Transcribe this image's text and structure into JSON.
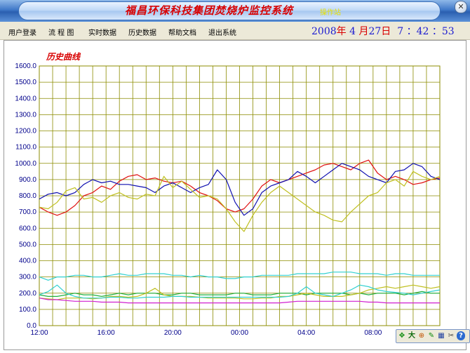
{
  "window": {
    "title": "福昌环保科技集团焚烧炉监控系统",
    "subtitle": "操作站",
    "close_glyph": "✕"
  },
  "menu": {
    "items": [
      "用户登录",
      "流 程 图",
      "实时数据",
      "历史数据",
      "帮助文档",
      "退出系统"
    ]
  },
  "clock": {
    "year": "2008",
    "year_unit": "年",
    "month": "4",
    "month_unit": "月",
    "day": "27",
    "day_unit": "日",
    "hour": "7",
    "sep1": "：",
    "minute": "42",
    "sep2": "：",
    "second": "53"
  },
  "colors": {
    "grid": "#8c8c00",
    "axis_text": "#00008b",
    "red_series": "#e01010",
    "blue_series": "#1010b0",
    "yellow_series": "#c0c020",
    "cyan_series": "#30d0d0",
    "green_series": "#20b040",
    "magenta_series": "#d020d0"
  },
  "toolbar": {
    "icons": [
      "move-icon",
      "zoom-in-icon",
      "zoom-region-icon",
      "pen-icon",
      "print-icon",
      "settings-icon",
      "help-icon"
    ],
    "glyphs": [
      "✥",
      "大",
      "⊕",
      "✎",
      "▦",
      "✂",
      "?"
    ]
  },
  "chart_data": {
    "type": "line",
    "title": "历史曲线",
    "ylim": [
      0,
      1600
    ],
    "y_ticks": [
      "0.0",
      "100.0",
      "200.0",
      "300.0",
      "400.0",
      "500.0",
      "600.0",
      "700.0",
      "800.0",
      "900.0",
      "1000.0",
      "1100.0",
      "1200.0",
      "1300.0",
      "1400.0",
      "1500.0",
      "1600.0"
    ],
    "x_ticks": [
      "12:00",
      "16:00",
      "20:00",
      "00:00",
      "04:00",
      "08:00"
    ],
    "grid": true,
    "series": [
      {
        "key": "red",
        "values": [
          730,
          700,
          680,
          700,
          740,
          800,
          820,
          860,
          840,
          890,
          920,
          930,
          900,
          910,
          890,
          880,
          890,
          860,
          820,
          800,
          770,
          720,
          700,
          720,
          780,
          860,
          900,
          880,
          900,
          920,
          940,
          960,
          990,
          1000,
          980,
          960,
          1000,
          1020,
          940,
          900,
          920,
          900,
          870,
          880,
          900,
          910
        ]
      },
      {
        "key": "blue",
        "values": [
          780,
          810,
          820,
          800,
          820,
          870,
          900,
          880,
          890,
          870,
          870,
          860,
          850,
          820,
          860,
          880,
          850,
          820,
          850,
          870,
          960,
          900,
          760,
          680,
          720,
          820,
          860,
          880,
          900,
          950,
          920,
          880,
          920,
          960,
          1000,
          980,
          960,
          920,
          900,
          880,
          950,
          960,
          1000,
          980,
          920,
          900
        ]
      },
      {
        "key": "yellow",
        "values": [
          730,
          720,
          760,
          830,
          850,
          780,
          790,
          760,
          800,
          820,
          790,
          780,
          810,
          800,
          920,
          850,
          890,
          840,
          790,
          800,
          780,
          720,
          640,
          580,
          680,
          760,
          820,
          860,
          820,
          780,
          740,
          700,
          680,
          650,
          640,
          700,
          750,
          800,
          820,
          880,
          900,
          860,
          950,
          920,
          900,
          920
        ]
      },
      {
        "key": "cyan",
        "values": [
          300,
          280,
          300,
          300,
          310,
          310,
          300,
          300,
          310,
          320,
          310,
          310,
          320,
          320,
          320,
          310,
          310,
          300,
          310,
          300,
          300,
          290,
          290,
          300,
          300,
          310,
          310,
          310,
          310,
          320,
          320,
          320,
          320,
          330,
          330,
          330,
          320,
          320,
          320,
          310,
          320,
          320,
          310,
          310,
          310,
          310
        ]
      },
      {
        "key": "green",
        "values": [
          190,
          180,
          180,
          190,
          200,
          190,
          190,
          180,
          190,
          200,
          190,
          200,
          200,
          200,
          190,
          190,
          200,
          200,
          190,
          190,
          190,
          190,
          200,
          200,
          190,
          190,
          190,
          200,
          200,
          200,
          190,
          200,
          200,
          200,
          200,
          190,
          200,
          190,
          200,
          200,
          200,
          190,
          200,
          210,
          200,
          200
        ]
      },
      {
        "key": "yellow2",
        "values": [
          170,
          165,
          160,
          170,
          170,
          170,
          165,
          170,
          180,
          180,
          175,
          180,
          200,
          230,
          190,
          180,
          180,
          180,
          175,
          170,
          170,
          170,
          170,
          165,
          165,
          170,
          170,
          180,
          180,
          190,
          200,
          190,
          180,
          180,
          180,
          190,
          200,
          220,
          230,
          240,
          230,
          240,
          250,
          240,
          230,
          240
        ]
      },
      {
        "key": "cyan2",
        "values": [
          190,
          210,
          250,
          200,
          180,
          170,
          170,
          170,
          175,
          175,
          170,
          170,
          175,
          175,
          175,
          180,
          180,
          175,
          175,
          175,
          175,
          175,
          175,
          175,
          175,
          175,
          175,
          175,
          180,
          200,
          240,
          200,
          190,
          180,
          200,
          220,
          250,
          240,
          220,
          210,
          205,
          200,
          190,
          200,
          210,
          220
        ]
      },
      {
        "key": "magenta",
        "values": [
          170,
          160,
          160,
          155,
          150,
          150,
          150,
          145,
          145,
          145,
          140,
          140,
          140,
          140,
          140,
          140,
          140,
          140,
          140,
          140,
          140,
          140,
          140,
          140,
          140,
          140,
          140,
          140,
          145,
          150,
          150,
          150,
          150,
          150,
          150,
          150,
          150,
          145,
          145,
          140,
          140,
          140,
          140,
          140,
          140,
          140
        ]
      }
    ]
  }
}
